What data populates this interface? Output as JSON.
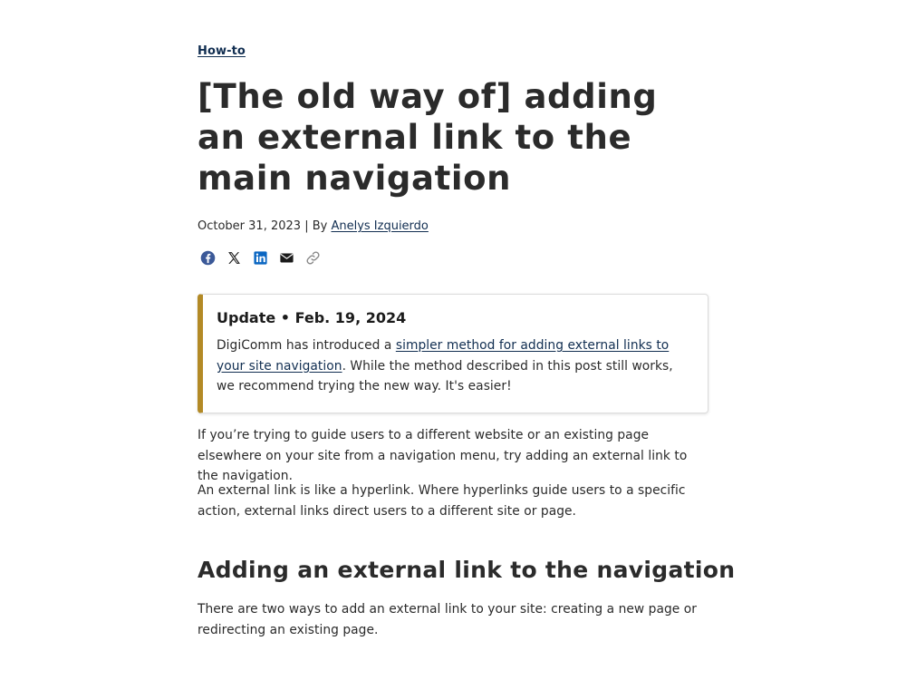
{
  "article": {
    "category": "How-to",
    "title": "[The old way of] adding an external link to the main navigation",
    "meta": {
      "date": "October 31, 2023",
      "separator": " | By ",
      "author": "Anelys Izquierdo"
    },
    "share": [
      {
        "name": "facebook-icon",
        "label": "Facebook",
        "color": "#3b5998"
      },
      {
        "name": "x-icon",
        "label": "X",
        "color": "#1b1b1b"
      },
      {
        "name": "linkedin-icon",
        "label": "LinkedIn",
        "color": "#0a66c2"
      },
      {
        "name": "email-icon",
        "label": "Email",
        "color": "#1b1b1b"
      },
      {
        "name": "copy-link-icon",
        "label": "Copy link",
        "color": "#8a8a8a"
      }
    ],
    "update": {
      "title": "Update • Feb. 19, 2024",
      "body_prefix": "DigiComm has introduced a ",
      "link_text": "simpler method for adding external links to your site navigation",
      "body_suffix": ". While the method described in this post still works, we recommend trying the new way. It's easier!",
      "accent_color": "#b38a26"
    },
    "paragraphs": [
      "If you’re trying to guide users to a different website or an existing page elsewhere on your site from a navigation menu, try adding an external link to the navigation.",
      "An external link is like a hyperlink. Where hyperlinks guide users to a specific action, external links direct users to a different site or page."
    ],
    "section": {
      "heading": "Adding an external link to the navigation",
      "paragraph": "There are two ways to add an external link to your site: creating a new page or redirecting an existing page."
    }
  },
  "colors": {
    "link": "#112e51",
    "text": "#2a2a2a",
    "heading": "#2b2b2b"
  }
}
